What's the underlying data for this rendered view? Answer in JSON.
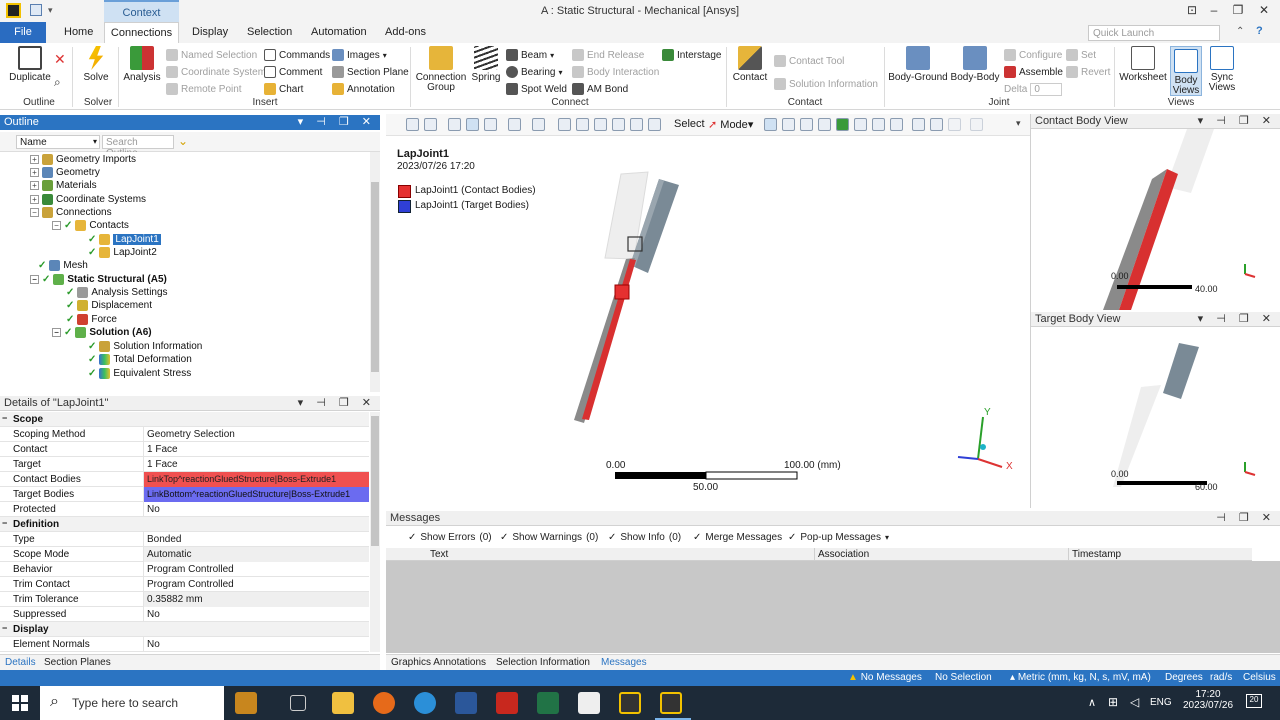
{
  "window": {
    "title": "A : Static Structural - Mechanical [Ansys]",
    "context_tab": "Context"
  },
  "tabs": [
    "File",
    "Home",
    "Connections",
    "Display",
    "Selection",
    "Automation",
    "Add-ons"
  ],
  "quick_launch_placeholder": "Quick Launch",
  "ribbon": {
    "outline": {
      "duplicate": "Duplicate",
      "label": "Outline"
    },
    "solver": {
      "solve": "Solve",
      "label": "Solver"
    },
    "analysis": "Analysis",
    "insert": {
      "named_selection": "Named Selection",
      "coordinate_system": "Coordinate System",
      "remote_point": "Remote Point",
      "commands": "Commands",
      "comment": "Comment",
      "chart": "Chart",
      "images": "Images",
      "section_plane": "Section Plane",
      "annotation": "Annotation",
      "label": "Insert"
    },
    "connect": {
      "connection_group_1": "Connection",
      "connection_group_2": "Group",
      "spring": "Spring",
      "beam": "Beam",
      "bearing": "Bearing",
      "spot_weld": "Spot Weld",
      "end_release": "End Release",
      "body_interaction": "Body Interaction",
      "am_bond": "AM Bond",
      "interstage": "Interstage",
      "label": "Connect"
    },
    "contact": {
      "contact": "Contact",
      "contact_tool": "Contact Tool",
      "solution_information": "Solution Information",
      "label": "Contact"
    },
    "joint": {
      "body_ground": "Body-Ground",
      "body_body": "Body-Body",
      "configure": "Configure",
      "assemble": "Assemble",
      "delta": "Delta",
      "delta_value": "0",
      "set": "Set",
      "revert": "Revert",
      "label": "Joint"
    },
    "views": {
      "worksheet": "Worksheet",
      "body_views_1": "Body",
      "body_views_2": "Views",
      "sync_views_1": "Sync",
      "sync_views_2": "Views",
      "label": "Views"
    }
  },
  "outline": {
    "title": "Outline",
    "filter_field": "Name",
    "search_placeholder": "Search Outline",
    "tree": [
      "Geometry Imports",
      "Geometry",
      "Materials",
      "Coordinate Systems",
      "Connections",
      "Contacts",
      "LapJoint1",
      "LapJoint2",
      "Mesh",
      "Static Structural (A5)",
      "Analysis Settings",
      "Displacement",
      "Force",
      "Solution (A6)",
      "Solution Information",
      "Total Deformation",
      "Equivalent Stress"
    ]
  },
  "details": {
    "title": "Details of \"LapJoint1\"",
    "sections": {
      "scope": "Scope",
      "definition": "Definition",
      "display": "Display"
    },
    "rows": {
      "scoping_method": [
        "Scoping Method",
        "Geometry Selection"
      ],
      "contact": [
        "Contact",
        "1 Face"
      ],
      "target": [
        "Target",
        "1 Face"
      ],
      "contact_bodies": [
        "Contact Bodies",
        "LinkTop^reactionGluedStructure|Boss-Extrude1"
      ],
      "target_bodies": [
        "Target Bodies",
        "LinkBottom^reactionGluedStructure|Boss-Extrude1"
      ],
      "protected": [
        "Protected",
        "No"
      ],
      "type": [
        "Type",
        "Bonded"
      ],
      "scope_mode": [
        "Scope Mode",
        "Automatic"
      ],
      "behavior": [
        "Behavior",
        "Program Controlled"
      ],
      "trim_contact": [
        "Trim Contact",
        "Program Controlled"
      ],
      "trim_tolerance": [
        "Trim Tolerance",
        "0.35882 mm"
      ],
      "suppressed": [
        "Suppressed",
        "No"
      ],
      "element_normals": [
        "Element Normals",
        "No"
      ]
    },
    "tabs": [
      "Details",
      "Section Planes"
    ]
  },
  "graphics": {
    "select_label": "Select",
    "mode_label": "Mode",
    "object_name": "LapJoint1",
    "timestamp": "2023/07/26 17:20",
    "legend": [
      {
        "label": "LapJoint1 (Contact Bodies)",
        "color": "#e53030"
      },
      {
        "label": "LapJoint1 (Target Bodies)",
        "color": "#2f3fd6"
      }
    ],
    "scale": {
      "min": "0.00",
      "max": "100.00 (mm)",
      "mid": "50.00"
    },
    "triad": {
      "x": "X",
      "y": "Y",
      "z": "Z"
    }
  },
  "contact_body_view": {
    "title": "Contact Body View",
    "scale_min": "0.00",
    "scale_max": "40.00"
  },
  "target_body_view": {
    "title": "Target Body View",
    "scale_min": "0.00",
    "scale_max": "60.00"
  },
  "messages": {
    "title": "Messages",
    "show_errors": "Show Errors",
    "errors_count": "(0)",
    "show_warnings": "Show Warnings",
    "warnings_count": "(0)",
    "show_info": "Show Info",
    "info_count": "(0)",
    "merge_messages": "Merge Messages",
    "popup_messages": "Pop-up Messages",
    "columns": [
      "Text",
      "Association",
      "Timestamp"
    ]
  },
  "graphics_tabs": [
    "Graphics Annotations",
    "Selection Information",
    "Messages"
  ],
  "status": {
    "messages": "No Messages",
    "selection": "No Selection",
    "units": "Metric (mm, kg, N, s, mV, mA)",
    "angle": "Degrees",
    "rotation": "rad/s",
    "temperature": "Celsius"
  },
  "taskbar": {
    "search_placeholder": "Type here to search",
    "lang": "ENG",
    "time": "17:20",
    "date": "2023/07/26",
    "notifications": "20"
  }
}
